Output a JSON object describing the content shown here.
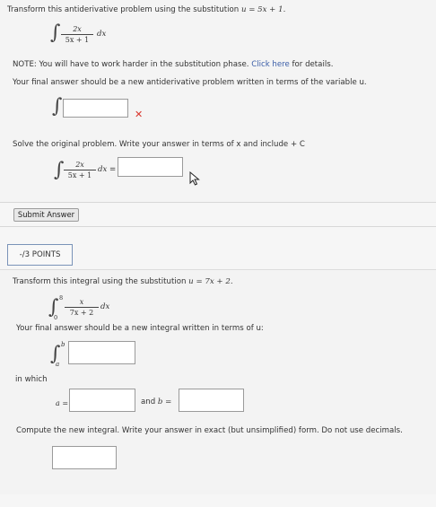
{
  "q1": {
    "intro_prefix": "Transform this antiderivative problem using the substitution",
    "intro_sub": "u = 5x + 1.",
    "integrand_num": "2x",
    "integrand_den": "5x + 1",
    "dx": "dx",
    "note_prefix": "NOTE: You will have to work harder in the substitution phase.",
    "note_link": "Click here",
    "note_suffix": "for details.",
    "final_prompt": "Your final answer should be a new antiderivative problem written in terms of the variable u.",
    "wrong_mark": "✕",
    "solve_prompt": "Solve the original problem. Write your answer in terms of x and include + C",
    "eq": "=",
    "submit_label": "Submit Answer"
  },
  "q2": {
    "points_label": "-/3 POINTS",
    "intro_prefix": "Transform this integral using the substitution",
    "intro_sub": "u = 7x + 2.",
    "upper": "8",
    "lower": "0",
    "integrand_num": "x",
    "integrand_den": "7x + 2",
    "dx": "dx",
    "final_prompt": "Your final answer should be a new integral written in terms of u:",
    "upper_var": "b",
    "lower_var": "a",
    "in_which": "in which",
    "a_label": "a =",
    "and_label": "and",
    "b_label": "b =",
    "compute_prompt": "Compute the new integral. Write your answer in exact (but unsimplified) form. Do not use decimals."
  },
  "colors": {
    "wrong": "#d9342b",
    "link": "#3b5ea8",
    "points_border": "#7a93b8"
  }
}
